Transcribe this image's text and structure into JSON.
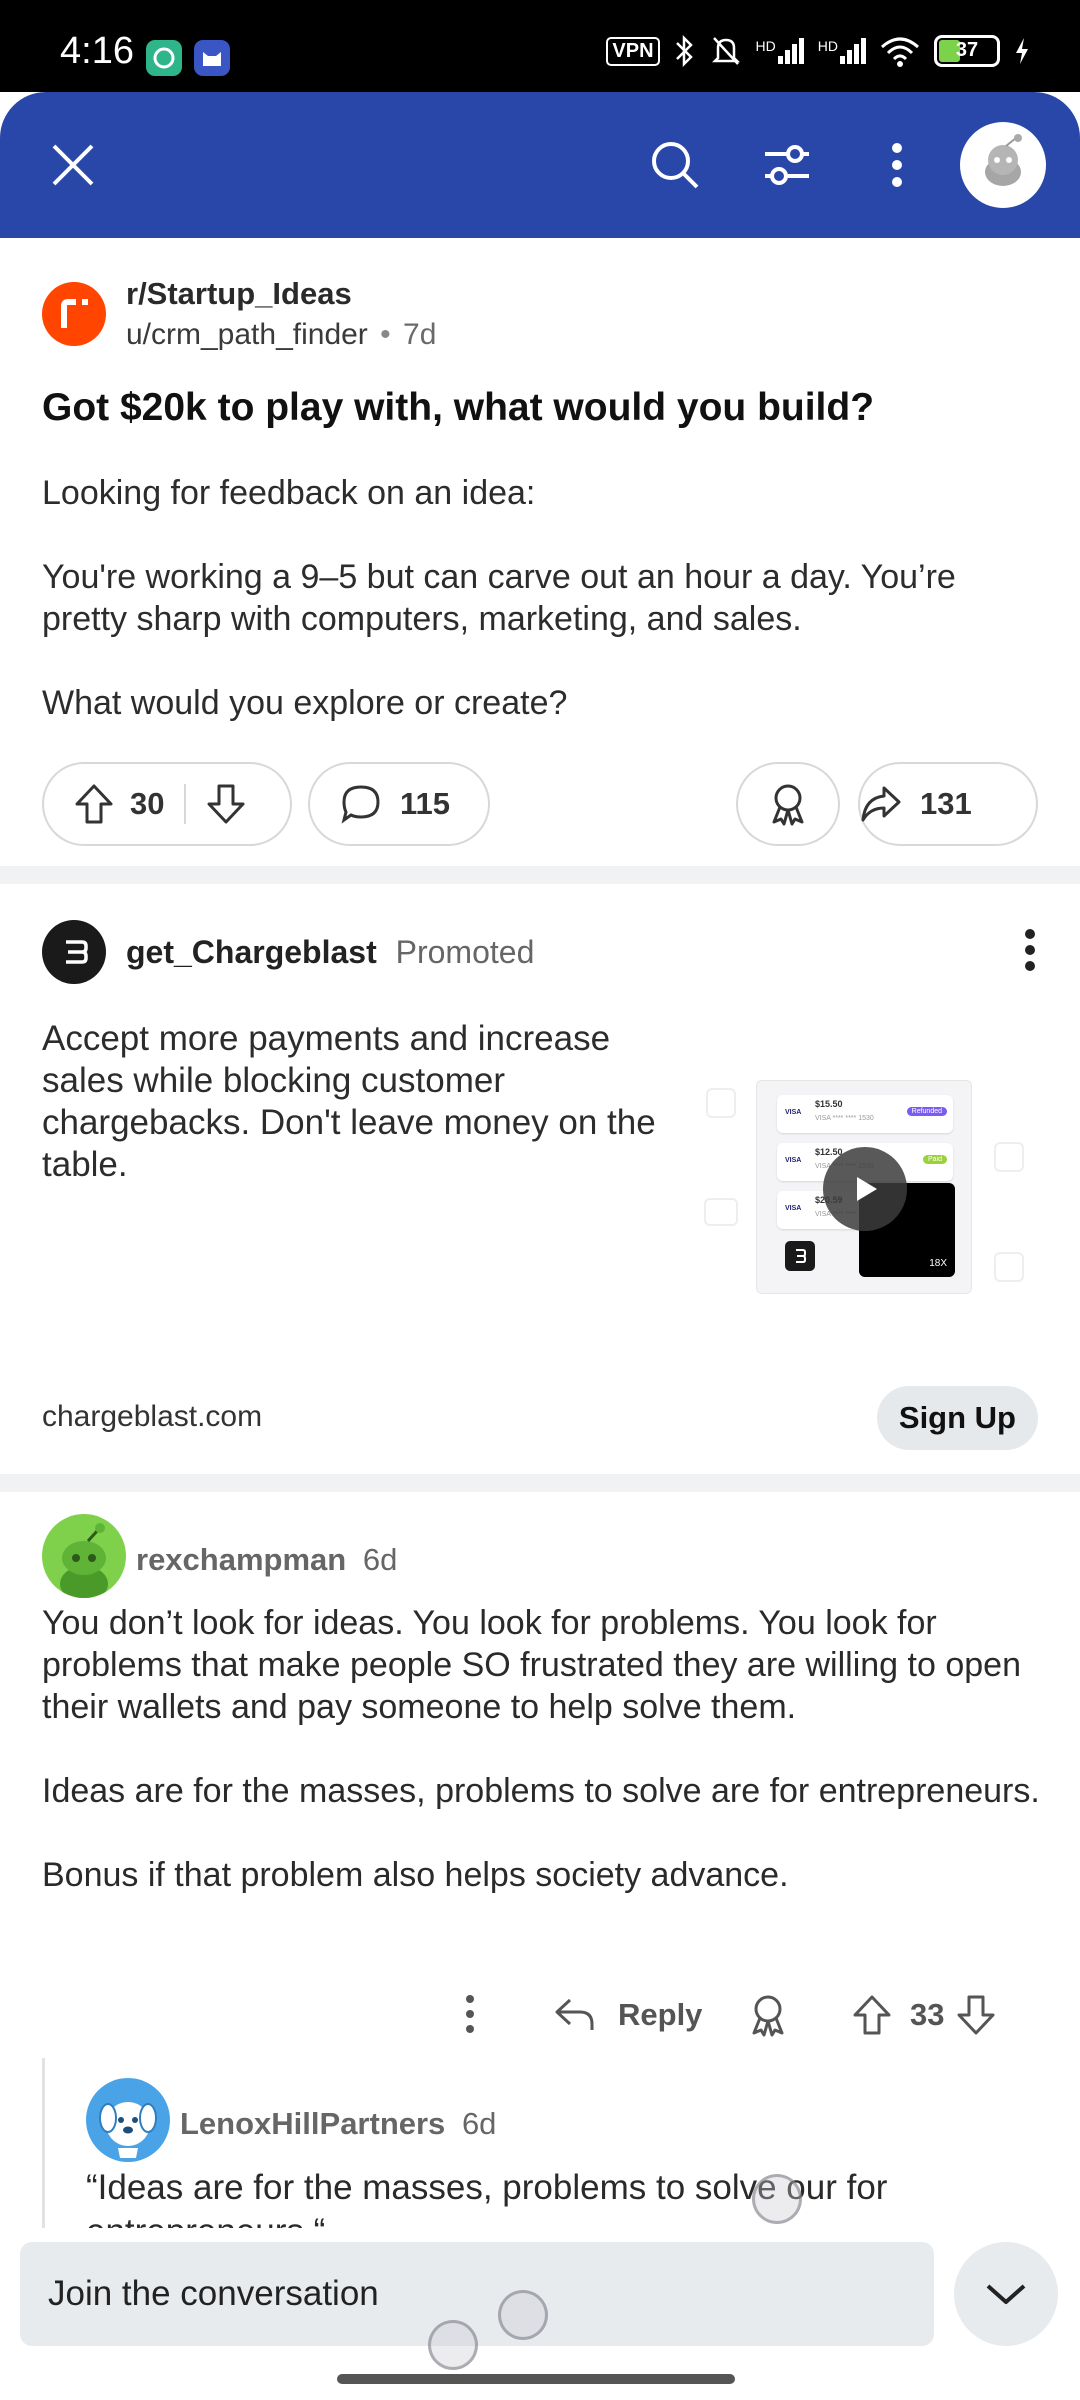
{
  "status_bar": {
    "time": "4:16",
    "vpn": "VPN",
    "network_1": "HD",
    "network_2": "HD",
    "battery": "37"
  },
  "app_bar": {
    "icons": [
      "close-icon",
      "search-icon",
      "filter-icon",
      "more-vert-icon",
      "profile-avatar"
    ]
  },
  "post": {
    "subreddit": "r/Startup_Ideas",
    "author": "u/crm_path_finder",
    "separator": "•",
    "age": "7d",
    "title": "Got $20k to play with, what would you build?",
    "body": [
      "Looking for feedback on an idea:",
      "You're working a 9–5 but can carve out an hour a day. You’re pretty sharp with computers, marketing, and sales.",
      "What would you explore or create?"
    ],
    "upvotes": "30",
    "comments": "115",
    "shares": "131"
  },
  "ad": {
    "advertiser": "get_Chargeblast",
    "promoted_label": "Promoted",
    "text": "Accept more payments and increase sales while blocking customer chargebacks. Don't leave money on the table.",
    "domain": "chargeblast.com",
    "cta": "Sign Up",
    "thumb": {
      "rows": [
        {
          "amount": "$15.50",
          "card": "VISA **** **** 1530",
          "tag": "Refunded"
        },
        {
          "amount": "$12.50",
          "card": "VISA **** **** 1530",
          "tag": "Paid"
        },
        {
          "amount": "$20.59",
          "card": "VISA **** **** 1530",
          "tag": ""
        }
      ],
      "badge": "18X"
    }
  },
  "comment": {
    "author": "rexchampman",
    "age": "6d",
    "body": [
      "You don’t look for ideas. You look for problems. You look for problems that make people SO frustrated they are willing to open their wallets and pay someone to help solve them.",
      "Ideas are for the masses, problems to solve are for entrepreneurs.",
      "Bonus if that problem also helps society advance."
    ],
    "reply_label": "Reply",
    "votes": "33"
  },
  "reply": {
    "author": "LenoxHillPartners",
    "age": "6d",
    "body": "“Ideas are for the masses, problems to solve our for entrepreneurs.“"
  },
  "bottom": {
    "placeholder": "Join the conversation"
  },
  "colors": {
    "header": "#2947a9",
    "subreddit_icon": "#ff4500",
    "divider": "#f0f2f4"
  }
}
